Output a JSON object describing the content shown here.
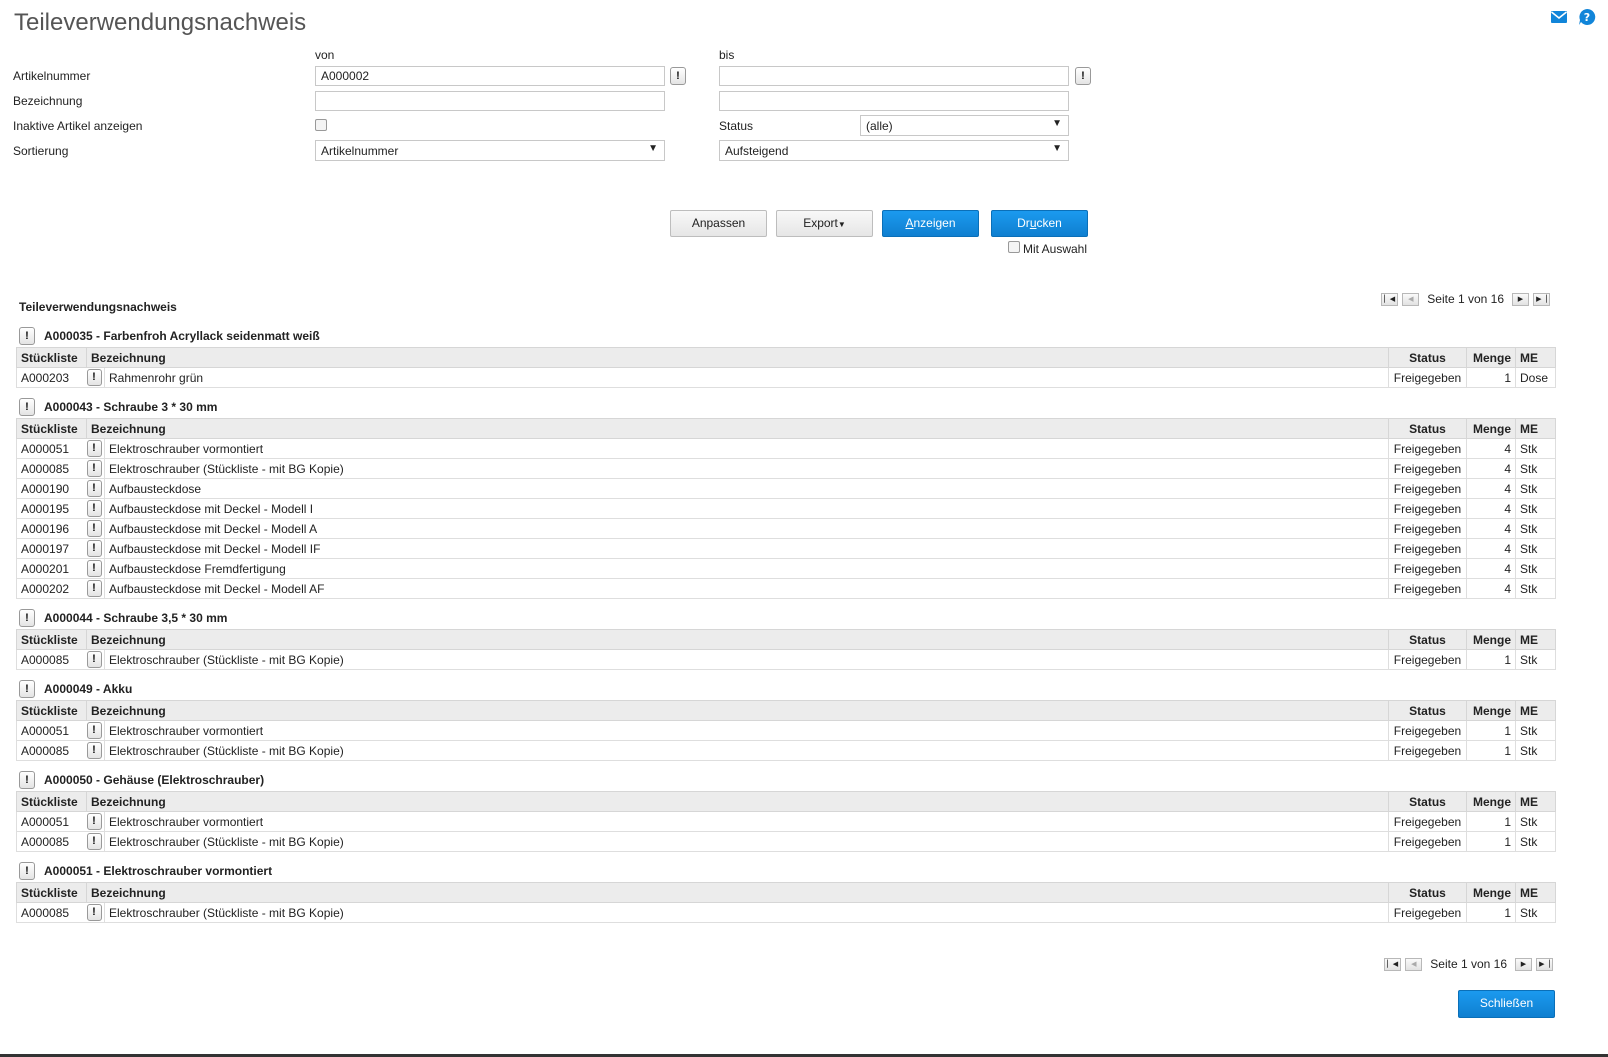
{
  "title": "Teileverwendungsnachweis",
  "icons": [
    "mail-icon",
    "help-icon"
  ],
  "filters": {
    "col_from": "von",
    "col_to": "bis",
    "articlenumber_label": "Artikelnummer",
    "articlenumber_from": "A000002",
    "articlenumber_to": "",
    "description_label": "Bezeichnung",
    "description_from": "",
    "description_to": "",
    "inactive_label": "Inaktive Artikel anzeigen",
    "status_label": "Status",
    "status_value": "(alle)",
    "sort_label": "Sortierung",
    "sort_field": "Artikelnummer",
    "sort_order": "Aufsteigend"
  },
  "buttons": {
    "adjust": "Anpassen",
    "export": "Export",
    "show_pre": "",
    "show_key": "A",
    "show_post": "nzeigen",
    "print_pre": "Dr",
    "print_key": "u",
    "print_post": "cken",
    "with_selection": "Mit Auswahl",
    "close": "Schließen"
  },
  "report": {
    "title": "Teileverwendungsnachweis",
    "pager_text": "Seite 1 von 16",
    "columns": {
      "bom": "Stückliste",
      "description": "Bezeichnung",
      "status": "Status",
      "qty": "Menge",
      "unit": "ME"
    },
    "groups": [
      {
        "heading": "A000035 - Farbenfroh Acryllack seidenmatt weiß",
        "rows": [
          {
            "bom": "A000203",
            "description": "Rahmenrohr grün",
            "status": "Freigegeben",
            "qty": "1",
            "unit": "Dose"
          }
        ]
      },
      {
        "heading": "A000043 - Schraube 3 * 30 mm",
        "rows": [
          {
            "bom": "A000051",
            "description": "Elektroschrauber vormontiert",
            "status": "Freigegeben",
            "qty": "4",
            "unit": "Stk"
          },
          {
            "bom": "A000085",
            "description": "Elektroschrauber (Stückliste - mit BG Kopie)",
            "status": "Freigegeben",
            "qty": "4",
            "unit": "Stk"
          },
          {
            "bom": "A000190",
            "description": "Aufbausteckdose",
            "status": "Freigegeben",
            "qty": "4",
            "unit": "Stk"
          },
          {
            "bom": "A000195",
            "description": "Aufbausteckdose mit Deckel - Modell I",
            "status": "Freigegeben",
            "qty": "4",
            "unit": "Stk"
          },
          {
            "bom": "A000196",
            "description": "Aufbausteckdose mit Deckel - Modell A",
            "status": "Freigegeben",
            "qty": "4",
            "unit": "Stk"
          },
          {
            "bom": "A000197",
            "description": "Aufbausteckdose mit Deckel - Modell IF",
            "status": "Freigegeben",
            "qty": "4",
            "unit": "Stk"
          },
          {
            "bom": "A000201",
            "description": "Aufbausteckdose Fremdfertigung",
            "status": "Freigegeben",
            "qty": "4",
            "unit": "Stk"
          },
          {
            "bom": "A000202",
            "description": "Aufbausteckdose mit Deckel - Modell AF",
            "status": "Freigegeben",
            "qty": "4",
            "unit": "Stk"
          }
        ]
      },
      {
        "heading": "A000044 - Schraube 3,5 * 30 mm",
        "rows": [
          {
            "bom": "A000085",
            "description": "Elektroschrauber (Stückliste - mit BG Kopie)",
            "status": "Freigegeben",
            "qty": "1",
            "unit": "Stk"
          }
        ]
      },
      {
        "heading": "A000049 - Akku",
        "rows": [
          {
            "bom": "A000051",
            "description": "Elektroschrauber vormontiert",
            "status": "Freigegeben",
            "qty": "1",
            "unit": "Stk"
          },
          {
            "bom": "A000085",
            "description": "Elektroschrauber (Stückliste - mit BG Kopie)",
            "status": "Freigegeben",
            "qty": "1",
            "unit": "Stk"
          }
        ]
      },
      {
        "heading": "A000050 - Gehäuse (Elektroschrauber)",
        "rows": [
          {
            "bom": "A000051",
            "description": "Elektroschrauber vormontiert",
            "status": "Freigegeben",
            "qty": "1",
            "unit": "Stk"
          },
          {
            "bom": "A000085",
            "description": "Elektroschrauber (Stückliste - mit BG Kopie)",
            "status": "Freigegeben",
            "qty": "1",
            "unit": "Stk"
          }
        ]
      },
      {
        "heading": "A000051 - Elektroschrauber vormontiert",
        "rows": [
          {
            "bom": "A000085",
            "description": "Elektroschrauber (Stückliste - mit BG Kopie)",
            "status": "Freigegeben",
            "qty": "1",
            "unit": "Stk"
          }
        ]
      }
    ]
  },
  "colors": {
    "accent": "#1185d9",
    "header_bg": "#ececec"
  }
}
